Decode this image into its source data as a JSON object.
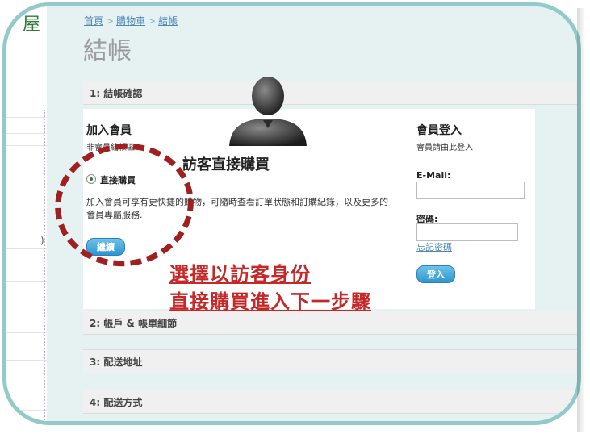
{
  "logo_text": "屋",
  "leftnote": ")",
  "breadcrumb": {
    "home": "首頁",
    "cart": "購物車",
    "current": "結帳",
    "separator": ">"
  },
  "page_title": "結帳",
  "steps": {
    "step1": "1: 結帳確認",
    "step2": "2: 帳戶 & 帳單細節",
    "step3": "3: 配送地址",
    "step4": "4: 配送方式"
  },
  "join": {
    "title": "加入會員",
    "subtitle": "非會員結帳區:",
    "radio_label": "直接購買",
    "description": "加入會員可享有更快捷的購物，可隨時查看訂單狀態和訂購紀錄，以及更多的會員專屬服務.",
    "continue_button": "繼續"
  },
  "login": {
    "title": "會員登入",
    "subtitle": "會員請由此登入",
    "email_label": "E-Mail:",
    "password_label": "密碼:",
    "forgot_link": "忘記密碼",
    "login_button": "登入"
  },
  "annotation": {
    "guest_caption": "訪客直接購買",
    "red_line1": "選擇以訪客身份",
    "red_line2": "直接購買進入下一步驟"
  },
  "colors": {
    "accent": "#2d95cf",
    "annotation_red": "#c62828",
    "frame": "#93c9c9"
  }
}
